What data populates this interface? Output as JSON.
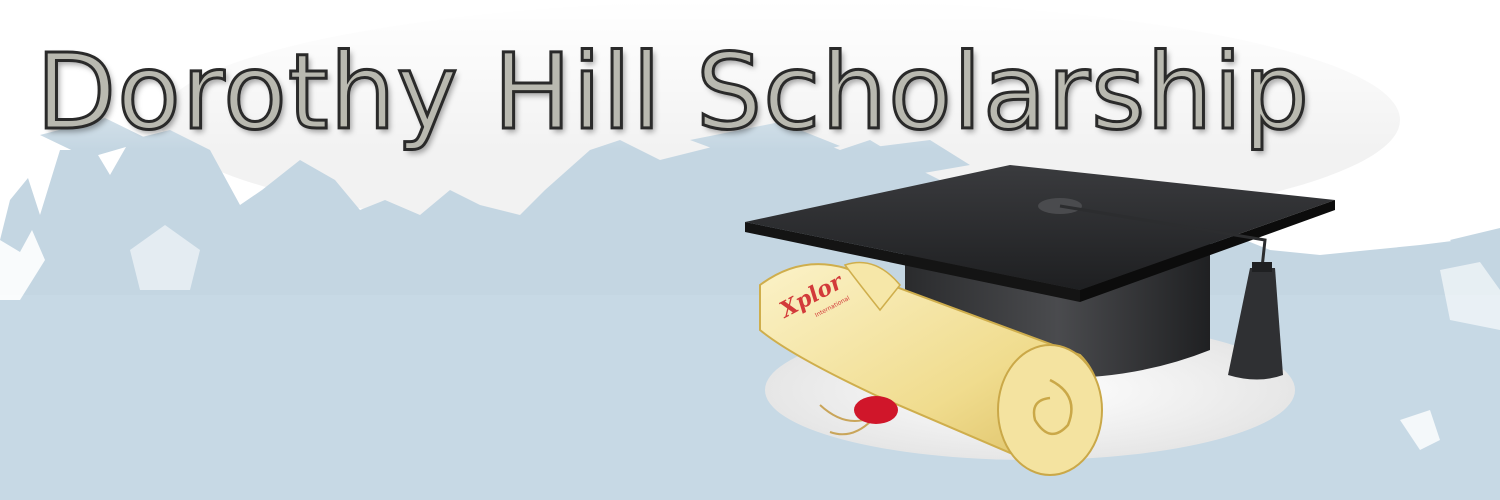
{
  "banner": {
    "title": "Dorothy Hill Scholarship",
    "logo_text": "Xplor",
    "logo_subtext": "International"
  },
  "colors": {
    "background": "#ffffff",
    "silhouette": "#c3d6e3",
    "cap": "#2b2c2e",
    "scroll": "#f3e3a0",
    "seal": "#d0162a",
    "logo": "#d23a3a"
  },
  "icons": {
    "graduation_cap": "graduation-cap-icon",
    "diploma": "diploma-scroll-icon",
    "seal": "wax-seal-icon"
  }
}
